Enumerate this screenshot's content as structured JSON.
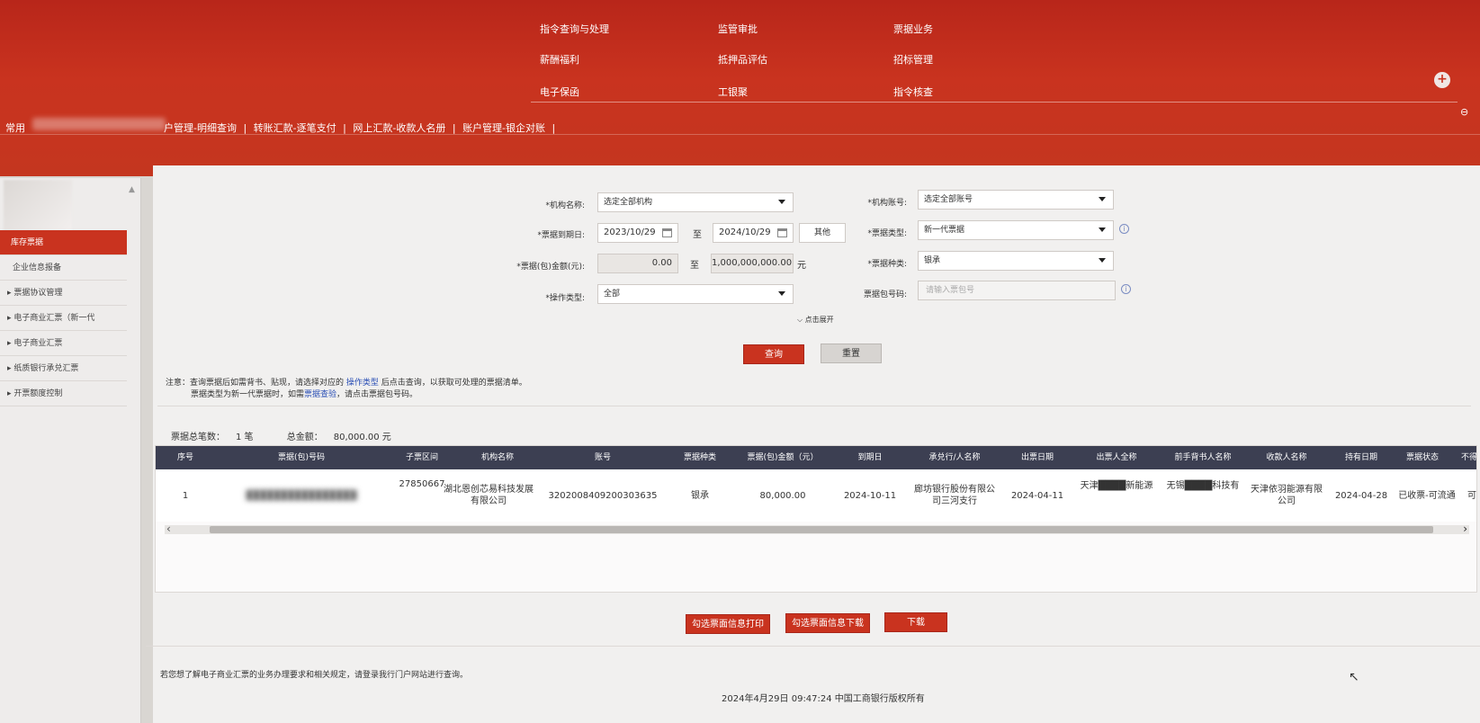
{
  "menu": {
    "items": [
      "指令查询与处理",
      "监管审批",
      "票据业务",
      "薪酬福利",
      "抵押品评估",
      "招标管理",
      "电子保函",
      "工银聚",
      "指令核查"
    ],
    "plus": "+"
  },
  "quickbar": {
    "label": "常用",
    "links": [
      "户管理-明细查询",
      "|",
      "转账汇款-逐笔支付",
      "|",
      "网上汇款-收款人名册",
      "|",
      "账户管理-银企对账",
      "|"
    ]
  },
  "sidebar": {
    "items": [
      "库存票据",
      "企业信息报备",
      "▸ 票据协议管理",
      "▸ 电子商业汇票（新一代",
      "▸ 电子商业汇票",
      "▸ 纸质银行承兑汇票",
      "▸ 开票额度控制"
    ]
  },
  "form": {
    "org_name_label": "*机构名称:",
    "org_name_value": "选定全部机构",
    "org_account_label": "*机构账号:",
    "org_account_value": "选定全部账号",
    "due_date_label": "*票据到期日:",
    "due_date_from": "2023/10/29",
    "to": "至",
    "due_date_to": "2024/10/29",
    "other": "其他",
    "bill_type_label": "*票据类型:",
    "bill_type_value": "新一代票据",
    "amount_label": "*票据(包)金额(元):",
    "amount_min": "0.00",
    "amount_max": "1,000,000,000.00",
    "amount_unit": "元",
    "bill_kind_label": "*票据种类:",
    "bill_kind_value": "银承",
    "op_type_label": "*操作类型:",
    "op_type_value": "全部",
    "package_no_label": "票据包号码:",
    "package_no_placeholder": "请输入票包号",
    "expand": "点击展开",
    "query_button": "查询",
    "reset_button": "重置"
  },
  "notice": {
    "line1_pre": "注意：查询票据后如需背书、贴现，请选择对应的 ",
    "line1_link": "操作类型",
    "line1_post": " 后点击查询，以获取可处理的票据清单。",
    "line2_pre": "票据类型为新一代票据时，如需",
    "line2_link": "票据查验",
    "line2_post": "，请点击票据包号码。"
  },
  "summary": {
    "count_label": "票据总笔数：",
    "count_value": "1 笔",
    "total_label": "总金额：",
    "total_value": "80,000.00 元"
  },
  "table": {
    "headers": [
      "序号",
      "票据(包)号码",
      "子票区间",
      "机构名称",
      "账号",
      "票据种类",
      "票据(包)金额（元）",
      "到期日",
      "承兑行/人名称",
      "出票日期",
      "出票人全称",
      "前手背书人名称",
      "收款人名称",
      "持有日期",
      "票据状态",
      "不得转让标记"
    ],
    "rows": [
      {
        "seq": "1",
        "bill_no": "████████████████",
        "sub_range": "27850667",
        "org_name": "湖北恩创芯易科技发展有限公司",
        "account": "3202008409200303635",
        "kind": "银承",
        "amount": "80,000.00",
        "due_date": "2024-10-11",
        "acceptor": "廊坊银行股份有限公司三河支行",
        "issue_date": "2024-04-11",
        "drawer": "天津████新能源",
        "endorser": "无锡████科技有",
        "payee": "天津依羽能源有限公司",
        "hold_date": "2024-04-28",
        "status": "已收票-可流通",
        "transfer_mark": "可再转让"
      }
    ]
  },
  "actions": {
    "print": "勾选票面信息打印",
    "download_selected": "勾选票面信息下载",
    "download": "下载"
  },
  "footer": {
    "note": "若您想了解电子商业汇票的业务办理要求和相关规定，请登录我行门户网站进行查询。",
    "copyright": "2024年4月29日 09:47:24   中国工商银行版权所有"
  }
}
